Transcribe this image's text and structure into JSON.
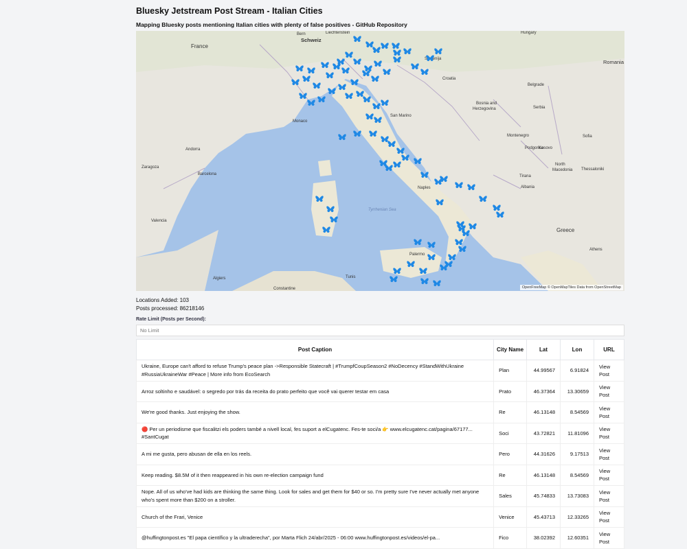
{
  "page": {
    "title": "Bluesky Jetstream Post Stream - Italian Cities",
    "subtitle": "Mapping Bluesky posts mentioning Italian cities with plenty of false positives - GitHub Repository"
  },
  "map": {
    "attribution": "OpenFreeMap © OpenMapTiles Data from OpenStreetMap",
    "marker_icon": "butterfly-icon",
    "marker_color": "#1e88e5",
    "labels": [
      "Bern",
      "Liechtenstein",
      "Schweiz/Suisse/Svizzera/Svizra",
      "Hungary",
      "France",
      "Slovenija",
      "Croatia",
      "Romania",
      "Belgrade Београд",
      "Bosnia and Herzegovina",
      "Serbia Србија",
      "Monaco",
      "San Marino",
      "Montenegro Црна Гора",
      "Sofia София",
      "Andorra",
      "Podgorica",
      "Kosovo",
      "North Macedonia Северна Македонија",
      "Zaragoza",
      "Barcelona",
      "Tirana",
      "Albania",
      "Naples",
      "Thessaloniki",
      "Valencia",
      "Greece Ελλάδα",
      "Palermo",
      "Athens Αθήνα",
      "Algiers",
      "Tunis",
      "Constantine",
      "Tyrrhenian Sea"
    ]
  },
  "stats": {
    "locations_label": "Locations Added:",
    "locations_value": "103",
    "posts_label": "Posts processed:",
    "posts_value": "86218146"
  },
  "rate": {
    "label": "Rate Limit (Posts per Second):",
    "placeholder": "No Limit"
  },
  "table": {
    "headers": [
      "Post Caption",
      "City Name",
      "Lat",
      "Lon",
      "URL"
    ],
    "rows": [
      {
        "caption": "Ukraine, Europe can't afford to refuse Trump's peace plan ->Responsible Statecraft | #TrumpfCoupSeason2 #NoDecency #StandWithUkraine #RussiaUkraineWar #Peace | More info from EcoSearch",
        "city": "Plan",
        "lat": "44.99567",
        "lon": "6.91824",
        "url": "View Post"
      },
      {
        "caption": "Arroz soltinho e saudável: o segredo por trás da receita do prato perfeito que você vai querer testar em casa",
        "city": "Prato",
        "lat": "46.37364",
        "lon": "13.30659",
        "url": "View Post"
      },
      {
        "caption": "We're good thanks. Just enjoying the show.",
        "city": "Re",
        "lat": "46.13148",
        "lon": "8.54569",
        "url": "View Post"
      },
      {
        "caption": "🔴 Per un periodisme que fiscalitzi els poders també a nivell local, fes suport a elCugatenc. Fes-te soci/a 👉 www.elcugatenc.cat/pagina/67177... #SantCugat",
        "city": "Soci",
        "lat": "43.72821",
        "lon": "11.81096",
        "url": "View Post"
      },
      {
        "caption": "A mi me gusta, pero abusan de ella en los reels.",
        "city": "Pero",
        "lat": "44.31626",
        "lon": "9.17513",
        "url": "View Post"
      },
      {
        "caption": "Keep reading. $8.5M of it then reappeared in his own re-election campaign fund",
        "city": "Re",
        "lat": "46.13148",
        "lon": "8.54569",
        "url": "View Post"
      },
      {
        "caption": "Nope. All of us who've had kids are thinking the same thing. Look for sales and get them for $40 or so. I'm pretty sure I've never actually met anyone who's spent more than $200 on a stroller.",
        "city": "Sales",
        "lat": "45.74833",
        "lon": "13.73083",
        "url": "View Post"
      },
      {
        "caption": "Church of the Frari, Venice",
        "city": "Venice",
        "lat": "45.43713",
        "lon": "12.33265",
        "url": "View Post"
      },
      {
        "caption": "@huffingtonpost.es \"El papa científico y la ultraderecha\", por Marta Flich 24/abr/2025 - 06:00 www.huffingtonpost.es/videos/el-pa...",
        "city": "Fico",
        "lat": "38.02392",
        "lon": "12.60351",
        "url": "View Post"
      }
    ]
  }
}
